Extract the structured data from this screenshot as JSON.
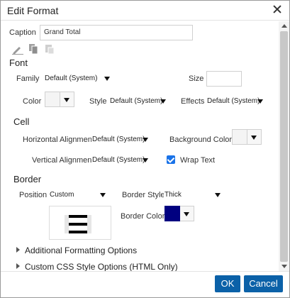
{
  "dialog": {
    "title": "Edit Format"
  },
  "caption": {
    "label": "Caption",
    "value": "Grand Total"
  },
  "toolbar_icons": [
    "pencil-icon",
    "copy-icon",
    "paste-icon"
  ],
  "font": {
    "heading": "Font",
    "family_label": "Family",
    "family_value": "Default (System)",
    "size_label": "Size",
    "size_value": "",
    "color_label": "Color",
    "style_label": "Style",
    "style_value": "Default (System)",
    "effects_label": "Effects",
    "effects_value": "Default (System)"
  },
  "cell": {
    "heading": "Cell",
    "h_align_label": "Horizontal Alignment",
    "h_align_value": "Default (System)",
    "bg_color_label": "Background Color",
    "v_align_label": "Vertical Alignment",
    "v_align_value": "Default (System)",
    "wrap_label": "Wrap Text",
    "wrap_checked": true
  },
  "border": {
    "heading": "Border",
    "position_label": "Position",
    "position_value": "Custom",
    "style_label": "Border Style",
    "style_value": "Thick",
    "color_label": "Border Color",
    "color_hex": "#000080"
  },
  "expanders": {
    "additional": "Additional Formatting Options",
    "custom_css": "Custom CSS Style Options (HTML Only)"
  },
  "buttons": {
    "ok": "OK",
    "cancel": "Cancel"
  },
  "colors": {
    "accent": "#0b61a8",
    "checkbox": "#1a73e8",
    "border_color": "#000080"
  }
}
